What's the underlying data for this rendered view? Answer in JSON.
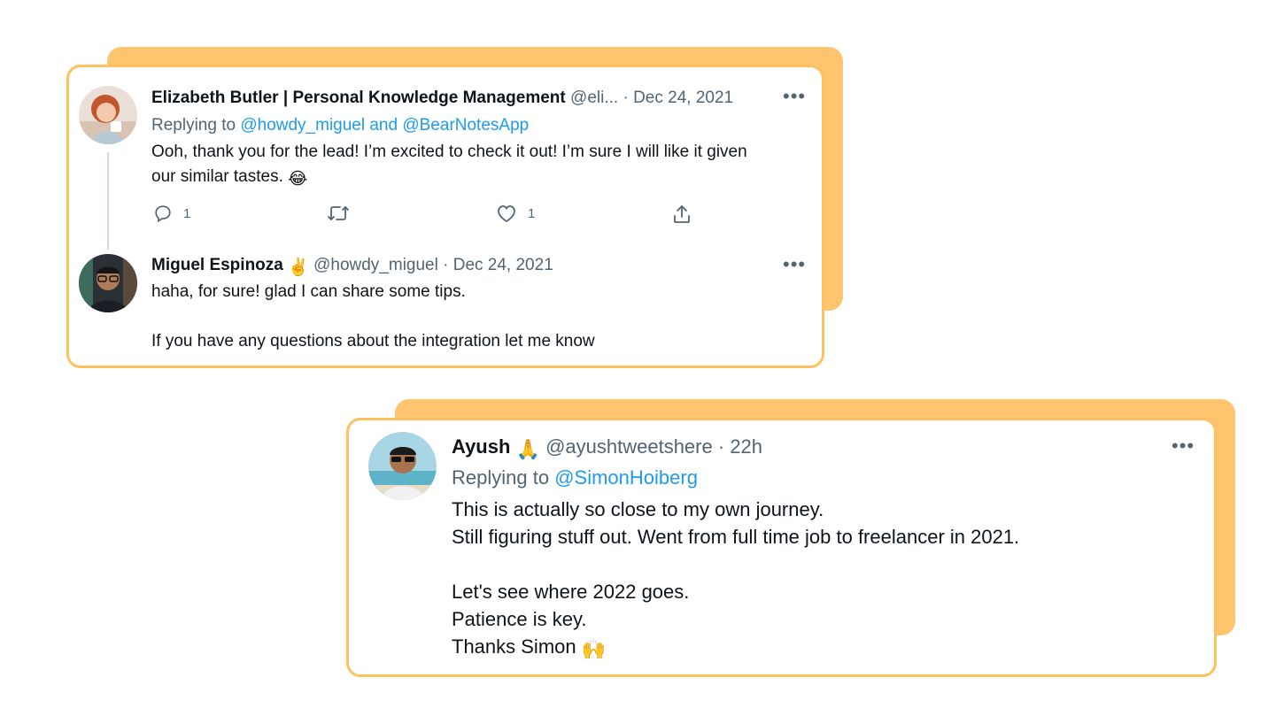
{
  "thread_card": {
    "tweet1": {
      "author_name": "Elizabeth Butler | Personal Knowledge Management",
      "handle": "@eli...",
      "separator": "·",
      "date": "Dec 24, 2021",
      "replying_prefix": "Replying to",
      "replying_mentions": "@howdy_miguel and @BearNotesApp",
      "text_line1": "Ooh, thank you for the lead! I’m excited to check it out! I’m sure I will like it given",
      "text_line2": "our similar tastes.",
      "text_emoji": "😂",
      "more_icon": "more-horizontal-icon",
      "actions": {
        "reply_icon": "reply-icon",
        "reply_count": "1",
        "retweet_icon": "retweet-icon",
        "like_icon": "heart-icon",
        "like_count": "1",
        "share_icon": "share-icon"
      }
    },
    "tweet2": {
      "author_name": "Miguel Espinoza",
      "author_emoji": "✌️",
      "handle": "@howdy_miguel",
      "separator": "·",
      "date": "Dec 24, 2021",
      "text_line1": "haha, for sure! glad I can share some tips.",
      "text_line2": "If you have any questions about the integration let me know",
      "more_icon": "more-horizontal-icon"
    }
  },
  "reply_card": {
    "author_name": "Ayush",
    "author_emoji": "🙏",
    "handle": "@ayushtweetshere",
    "separator": "·",
    "date": "22h",
    "replying_prefix": "Replying to",
    "replying_mentions": "@SimonHoiberg",
    "lines": [
      "This is actually so close to my own journey.",
      "Still figuring stuff out. Went from full time job to freelancer in 2021.",
      "Let's see where 2022 goes.",
      "Patience is key.",
      "Thanks Simon"
    ],
    "closing_emoji": "🙌",
    "more_icon": "more-horizontal-icon"
  },
  "colors": {
    "accent_shadow": "#ffc56e",
    "card_border": "#ffc15f",
    "mention_blue": "#1d9bf0",
    "secondary_text": "#536471"
  }
}
